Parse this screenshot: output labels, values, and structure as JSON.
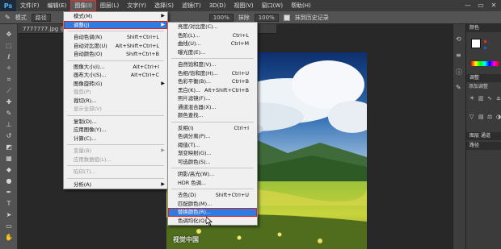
{
  "app": {
    "logo": "Ps"
  },
  "menubar": {
    "items": [
      "文件(F)",
      "编辑(E)",
      "图像(I)",
      "图层(L)",
      "文字(Y)",
      "选择(S)",
      "滤镜(T)",
      "3D(D)",
      "视图(V)",
      "窗口(W)",
      "帮助(H)"
    ],
    "active": "图像(I)"
  },
  "window_controls": {
    "minimize": "—",
    "restore": "▭",
    "close": "✕"
  },
  "options_bar": {
    "mode_label": "模式",
    "mode_value": "路径",
    "opacity": "100%",
    "smooth_label": "抹除",
    "flow": "100%",
    "checkbox_label": "抹到历史记录"
  },
  "document": {
    "tab_title": "7777777.jpg @ 66.7%(RGB/8#)"
  },
  "image_menu": {
    "items": [
      {
        "label": "模式(M)",
        "shortcut": "",
        "submenu": true,
        "disabled": false
      },
      {
        "label": "调整(J)",
        "shortcut": "",
        "submenu": true,
        "disabled": false,
        "highlighted": true
      },
      {
        "sep": true
      },
      {
        "label": "自动色调(N)",
        "shortcut": "Shift+Ctrl+L",
        "disabled": false
      },
      {
        "label": "自动对比度(U)",
        "shortcut": "Alt+Shift+Ctrl+L",
        "disabled": false
      },
      {
        "label": "自动颜色(O)",
        "shortcut": "Shift+Ctrl+B",
        "disabled": false
      },
      {
        "sep": true
      },
      {
        "label": "图像大小(I)...",
        "shortcut": "Alt+Ctrl+I",
        "disabled": false
      },
      {
        "label": "画布大小(S)...",
        "shortcut": "Alt+Ctrl+C",
        "disabled": false
      },
      {
        "label": "图像旋转(G)",
        "shortcut": "",
        "submenu": true,
        "disabled": false
      },
      {
        "label": "裁剪(P)",
        "shortcut": "",
        "disabled": true
      },
      {
        "label": "裁切(R)...",
        "shortcut": "",
        "disabled": false
      },
      {
        "label": "显示全部(V)",
        "shortcut": "",
        "disabled": true
      },
      {
        "sep": true
      },
      {
        "label": "复制(D)...",
        "shortcut": "",
        "disabled": false
      },
      {
        "label": "应用图像(Y)...",
        "shortcut": "",
        "disabled": false
      },
      {
        "label": "计算(C)...",
        "shortcut": "",
        "disabled": false
      },
      {
        "sep": true
      },
      {
        "label": "变量(B)",
        "shortcut": "",
        "submenu": true,
        "disabled": true
      },
      {
        "label": "应用数据组(L)...",
        "shortcut": "",
        "disabled": true
      },
      {
        "sep": true
      },
      {
        "label": "陷印(T)...",
        "shortcut": "",
        "disabled": true
      },
      {
        "sep": true
      },
      {
        "label": "分析(A)",
        "shortcut": "",
        "submenu": true,
        "disabled": false
      }
    ]
  },
  "adjust_submenu": {
    "items": [
      {
        "label": "亮度/对比度(C)...",
        "shortcut": ""
      },
      {
        "label": "色阶(L)...",
        "shortcut": "Ctrl+L"
      },
      {
        "label": "曲线(U)...",
        "shortcut": "Ctrl+M"
      },
      {
        "label": "曝光度(E)...",
        "shortcut": ""
      },
      {
        "sep": true
      },
      {
        "label": "自然饱和度(V)...",
        "shortcut": ""
      },
      {
        "label": "色相/饱和度(H)...",
        "shortcut": "Ctrl+U"
      },
      {
        "label": "色彩平衡(B)...",
        "shortcut": "Ctrl+B"
      },
      {
        "label": "黑白(K)...",
        "shortcut": "Alt+Shift+Ctrl+B"
      },
      {
        "label": "照片滤镜(F)...",
        "shortcut": ""
      },
      {
        "label": "通道混合器(X)...",
        "shortcut": ""
      },
      {
        "label": "颜色查找...",
        "shortcut": ""
      },
      {
        "sep": true
      },
      {
        "label": "反相(I)",
        "shortcut": "Ctrl+I"
      },
      {
        "label": "色调分离(P)...",
        "shortcut": ""
      },
      {
        "label": "阈值(T)...",
        "shortcut": ""
      },
      {
        "label": "渐变映射(G)...",
        "shortcut": ""
      },
      {
        "label": "可选颜色(S)...",
        "shortcut": ""
      },
      {
        "sep": true
      },
      {
        "label": "阴影/高光(W)...",
        "shortcut": ""
      },
      {
        "label": "HDR 色调...",
        "shortcut": ""
      },
      {
        "sep": true
      },
      {
        "label": "去色(D)",
        "shortcut": "Shift+Ctrl+U"
      },
      {
        "label": "匹配颜色(M)...",
        "shortcut": ""
      },
      {
        "label": "替换颜色(R)...",
        "shortcut": "",
        "highlighted": true
      },
      {
        "label": "色调均化(Q)",
        "shortcut": ""
      }
    ]
  },
  "panels": {
    "color_tab": "颜色",
    "swatches_tab": "色板",
    "adjust_tab": "调整",
    "adjust_add": "添加调整",
    "layers_tab": "图层",
    "channels_tab": "通道",
    "paths_tab": "路径"
  },
  "watermark": "视觉中国",
  "colors": {
    "menu_highlight": "#2f7be0",
    "annotation_red": "#e02020",
    "swatch_red": "#e53030",
    "swatch_blue": "#1e60d8"
  }
}
